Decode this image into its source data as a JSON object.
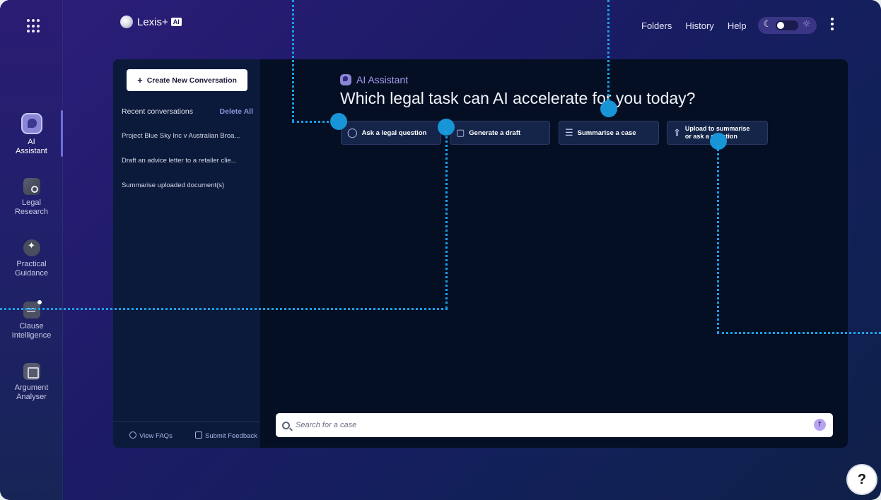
{
  "app": {
    "name": "Lexis+",
    "badge": "AI"
  },
  "rail": {
    "items": [
      {
        "label_line1": "AI",
        "label_line2": "Assistant"
      },
      {
        "label_line1": "Legal",
        "label_line2": "Research"
      },
      {
        "label_line1": "Practical",
        "label_line2": "Guidance"
      },
      {
        "label_line1": "Clause",
        "label_line2": "Intelligence"
      },
      {
        "label_line1": "Argument",
        "label_line2": "Analyser"
      }
    ]
  },
  "nav": {
    "folders": "Folders",
    "history": "History",
    "help": "Help"
  },
  "sidebar": {
    "create_label": "Create New Conversation",
    "recent_label": "Recent conversations",
    "delete_all": "Delete All",
    "conversations": [
      "Project Blue Sky Inc v Australian Broa...",
      "Draft an advice letter to a retailer clie...",
      "Summarise uploaded document(s)"
    ],
    "view_faqs": "View FAQs",
    "submit_feedback": "Submit Feedback"
  },
  "main": {
    "assistant_label": "AI Assistant",
    "headline": "Which legal task can AI accelerate for you today?",
    "actions": {
      "ask": "Ask a legal question",
      "draft": "Generate a draft",
      "summarise": "Summarise a case",
      "upload_line1": "Upload to summarise",
      "upload_line2": "or ask a question"
    },
    "search_placeholder": "Search for a case"
  },
  "help_fab": "?",
  "colors": {
    "accent": "#1795d6",
    "brand": "#2d1e7a",
    "panel": "#050f24"
  }
}
